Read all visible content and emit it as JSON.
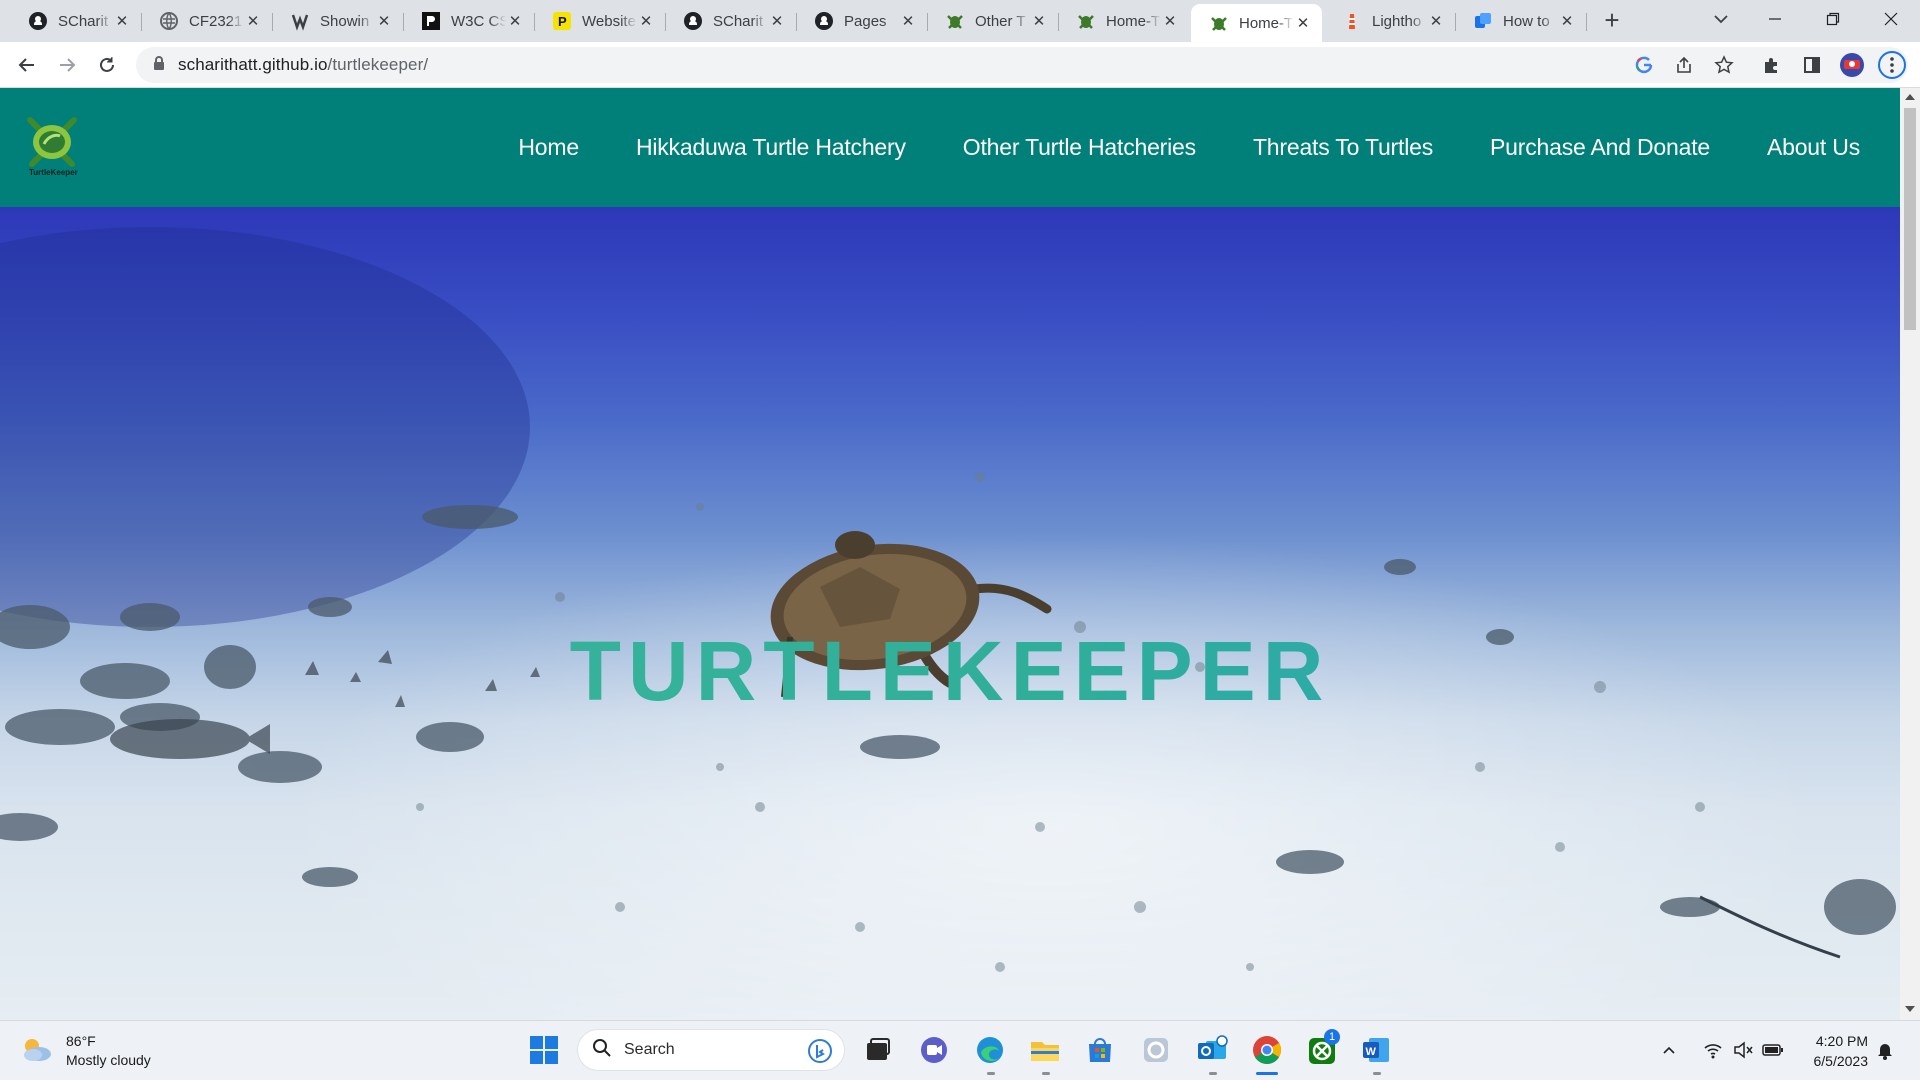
{
  "browser": {
    "tabs": [
      {
        "title": "SCharit",
        "favicon": "github-icon"
      },
      {
        "title": "CF2321",
        "favicon": "globe-icon"
      },
      {
        "title": "Showin",
        "favicon": "app-icon"
      },
      {
        "title": "W3C CS",
        "favicon": "w3c-icon"
      },
      {
        "title": "Website",
        "favicon": "p-icon"
      },
      {
        "title": "SCharit",
        "favicon": "github-icon"
      },
      {
        "title": "Pages",
        "favicon": "github-icon"
      },
      {
        "title": "Other T",
        "favicon": "turtle-icon"
      },
      {
        "title": "Home-T",
        "favicon": "turtle-icon"
      },
      {
        "title": "Home-T",
        "favicon": "turtle-icon",
        "active": true
      },
      {
        "title": "Lightho",
        "favicon": "lighthouse-icon"
      },
      {
        "title": "How to",
        "favicon": "blue-app-icon"
      }
    ],
    "url_host": "scharithatt.github.io",
    "url_path": "/turtlekeeper/"
  },
  "site": {
    "logo_text": "TurtleKeeper",
    "nav": [
      "Home",
      "Hikkaduwa Turtle Hatchery",
      "Other Turtle Hatcheries",
      "Threats To Turtles",
      "Purchase And Donate",
      "About Us"
    ],
    "hero_title": "TURTLEKEEPER",
    "brand_color": "#018079"
  },
  "taskbar": {
    "weather_temp": "86°F",
    "weather_desc": "Mostly cloudy",
    "search_label": "Search",
    "time": "4:20 PM",
    "date": "6/5/2023",
    "xbox_badge": "1"
  }
}
